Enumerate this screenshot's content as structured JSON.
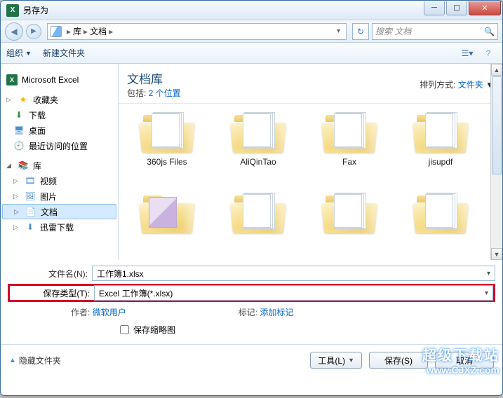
{
  "window": {
    "title": "另存为"
  },
  "nav": {
    "crumb1": "库",
    "crumb2": "文档",
    "search_placeholder": "搜索 文档"
  },
  "toolbar": {
    "organize": "组织",
    "newfolder": "新建文件夹"
  },
  "sidebar": {
    "excel": "Microsoft Excel",
    "fav": "收藏夹",
    "dl": "下载",
    "desk": "桌面",
    "recent": "最近访问的位置",
    "lib": "库",
    "vid": "视频",
    "pic": "图片",
    "doc": "文档",
    "xl": "迅雷下载"
  },
  "content": {
    "title": "文档库",
    "sub_label": "包括:",
    "sub_value": "2 个位置",
    "sort_label": "排列方式:",
    "sort_value": "文件夹",
    "folders": [
      "360js Files",
      "AliQinTao",
      "Fax",
      "jisupdf",
      "",
      "",
      "",
      ""
    ]
  },
  "form": {
    "filename_label": "文件名(N):",
    "filename_value": "工作簿1.xlsx",
    "filetype_label": "保存类型(T):",
    "filetype_value": "Excel 工作簿(*.xlsx)",
    "author_label": "作者:",
    "author_value": "微软用户",
    "tag_label": "标记:",
    "tag_value": "添加标记",
    "thumb_label": "保存缩略图"
  },
  "footer": {
    "hide": "隐藏文件夹",
    "tools": "工具(L)",
    "save": "保存(S)",
    "cancel": "取消"
  },
  "watermark": {
    "l1": "超级下载站",
    "l2": "www.CJXZ.com"
  }
}
